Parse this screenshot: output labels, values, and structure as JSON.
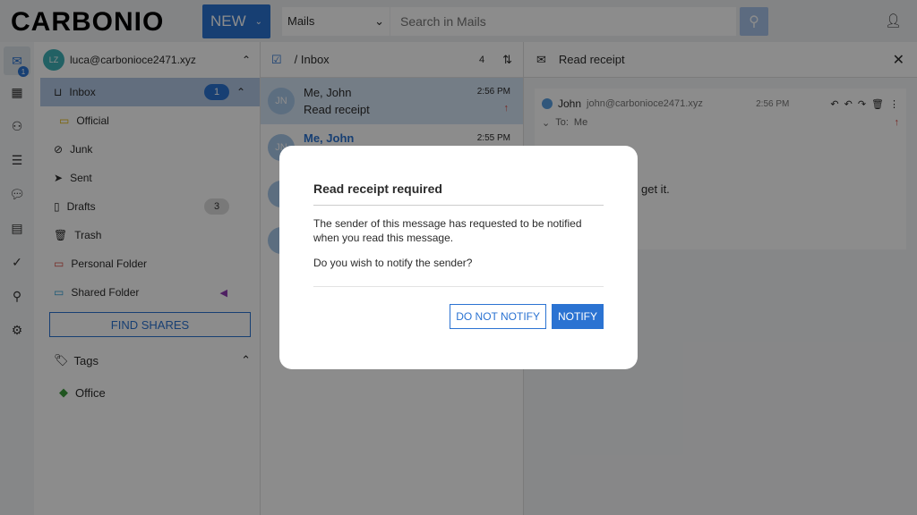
{
  "header": {
    "logo": "CARBONIO",
    "new_label": "NEW",
    "module": "Mails",
    "search_placeholder": "Search in Mails"
  },
  "rail": {
    "mail_badge": "1"
  },
  "folders": {
    "account": "luca@carbonioce2471.xyz",
    "account_initials": "LZ",
    "items": [
      {
        "label": "Inbox",
        "count": "1"
      },
      {
        "label": "Official"
      },
      {
        "label": "Junk"
      },
      {
        "label": "Sent"
      },
      {
        "label": "Drafts",
        "count": "3"
      },
      {
        "label": "Trash"
      },
      {
        "label": "Personal Folder"
      },
      {
        "label": "Shared Folder"
      }
    ],
    "find_shares": "FIND SHARES",
    "tags_label": "Tags",
    "tags": [
      {
        "label": "Office"
      }
    ]
  },
  "list": {
    "title": "/ Inbox",
    "count": "4",
    "rows": [
      {
        "initials": "JN",
        "from": "Me, John",
        "subject": "Read receipt",
        "time": "2:56 PM"
      },
      {
        "initials": "JN",
        "from": "Me, John",
        "time": "2:55 PM"
      }
    ]
  },
  "reader": {
    "title": "Read receipt",
    "from_name": "John",
    "from_email": "john@carbonioce2471.xyz",
    "time": "2:56 PM",
    "to_label": "To:",
    "to": "Me",
    "body_fragment": "get it."
  },
  "modal": {
    "title": "Read receipt required",
    "text1": "The sender of this message has requested to be notified when you read this message.",
    "text2": "Do you wish to notify the sender?",
    "cancel": "DO NOT NOTIFY",
    "confirm": "NOTIFY"
  },
  "colors": {
    "accent": "#2b73d2",
    "danger": "#d74942"
  }
}
